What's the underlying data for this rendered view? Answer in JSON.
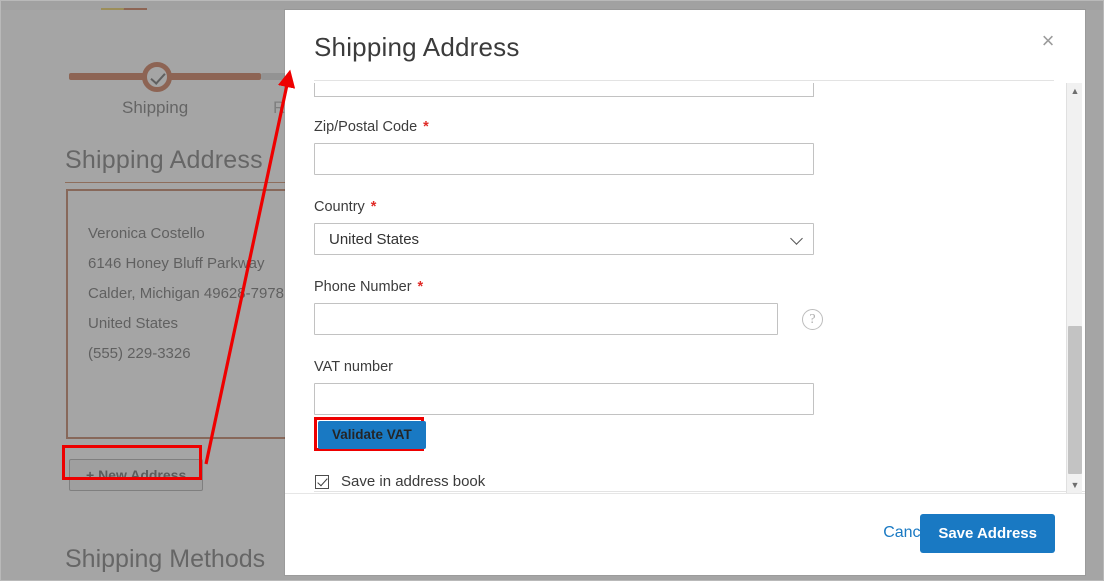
{
  "background": {
    "progress": {
      "steps": [
        {
          "label": "Shipping",
          "state": "complete"
        },
        {
          "label": "Review & Payments",
          "state": "upcoming",
          "visible_text": "Re"
        }
      ]
    },
    "section_title": "Shipping Address",
    "address_card": {
      "name": "Veronica Costello",
      "street": "6146 Honey Bluff Parkway",
      "city_state_zip": "Calder, Michigan 49628-7978",
      "country": "United States",
      "phone": "(555) 229-3326"
    },
    "new_address_button": "+ New Address",
    "next_section_title": "Shipping Methods"
  },
  "modal": {
    "title": "Shipping Address",
    "close_label": "×",
    "fields": [
      {
        "name": "zip_postal_code",
        "label": "Zip/Postal Code",
        "required": true,
        "value": "",
        "type": "text"
      },
      {
        "name": "country",
        "label": "Country",
        "required": true,
        "value": "United States",
        "type": "select"
      },
      {
        "name": "phone_number",
        "label": "Phone Number",
        "required": true,
        "value": "",
        "type": "text",
        "has_help_icon": true
      },
      {
        "name": "vat_number",
        "label": "VAT number",
        "required": false,
        "value": "",
        "type": "text"
      }
    ],
    "required_marker": "*",
    "validate_vat_button": "Validate VAT",
    "save_in_address_book": {
      "label": "Save in address book",
      "checked": true
    },
    "footer": {
      "cancel_label": "Cancel",
      "save_label": "Save Address"
    },
    "scrollbar": {
      "up_arrow": "▲",
      "down_arrow": "▼"
    }
  },
  "annotations": {
    "highlight_color": "#ee0000",
    "highlighted_elements": [
      "+ New Address",
      "Validate VAT"
    ],
    "arrow": {
      "from": "+ New Address",
      "to": "Shipping Address modal"
    }
  },
  "colors": {
    "primary_blue": "#1979c3",
    "accent_orange": "#c0562a",
    "required_red": "#e02b27",
    "annotation_red": "#ee0000"
  }
}
